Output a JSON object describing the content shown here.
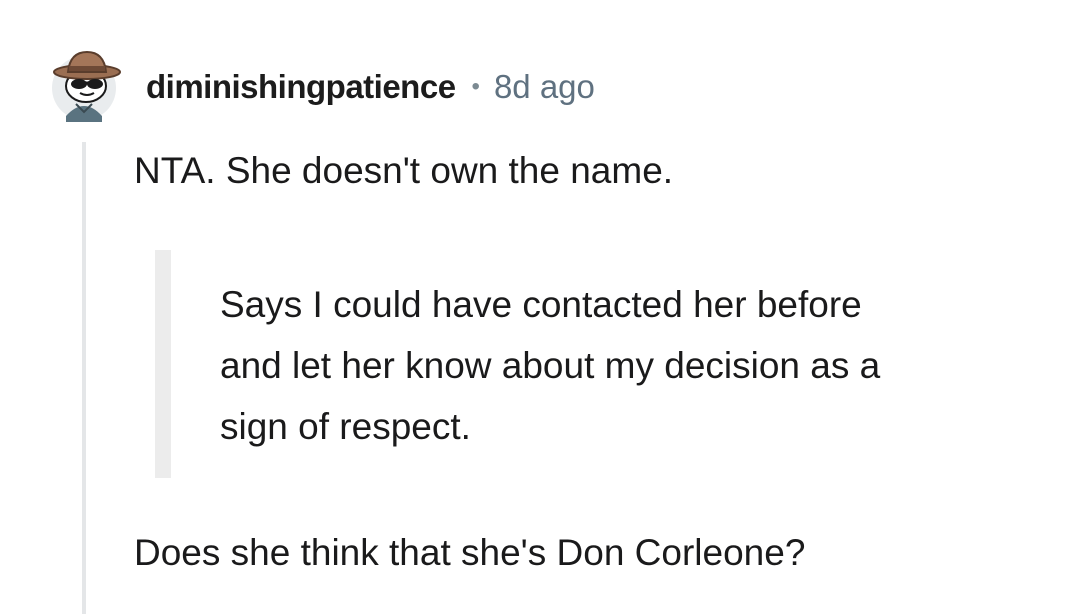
{
  "comment": {
    "author": {
      "username": "diminishingpatience",
      "avatar_icon": "snoo-avatar-icon"
    },
    "separator": "•",
    "timestamp": "8d ago",
    "body": {
      "paragraph_1": "NTA. She doesn't own the name.",
      "blockquote_lines": [
        "Says I could have contacted her before",
        "and let her know about my decision as a",
        "sign of respect."
      ],
      "paragraph_2": "Does she think that she's Don Corleone?"
    }
  },
  "colors": {
    "text": "#1a1a1b",
    "muted": "#5f7180",
    "thread_line": "#e4e6e8",
    "quote_bar": "#ececec"
  }
}
